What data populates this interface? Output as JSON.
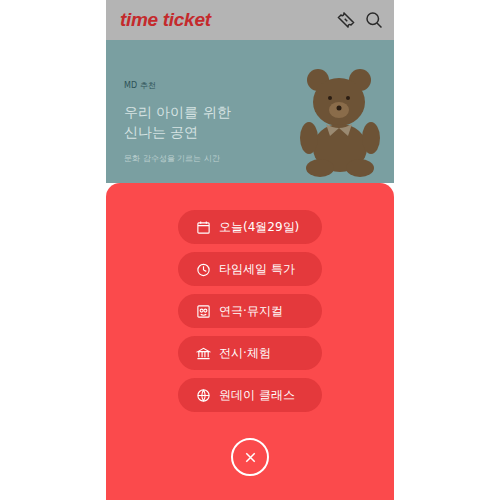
{
  "header": {
    "logo": "time ticket"
  },
  "banner": {
    "label": "MD 추천",
    "title": [
      "우리 아이를 위한",
      "신나는 공연"
    ],
    "subtitle": "문화 감수성을 기르는 시간"
  },
  "menu": [
    {
      "label": "오늘(4월29일)"
    },
    {
      "label": "타임세일 특가"
    },
    {
      "label": "연극·뮤지컬"
    },
    {
      "label": "전시·체험"
    },
    {
      "label": "원데이 클래스"
    }
  ]
}
